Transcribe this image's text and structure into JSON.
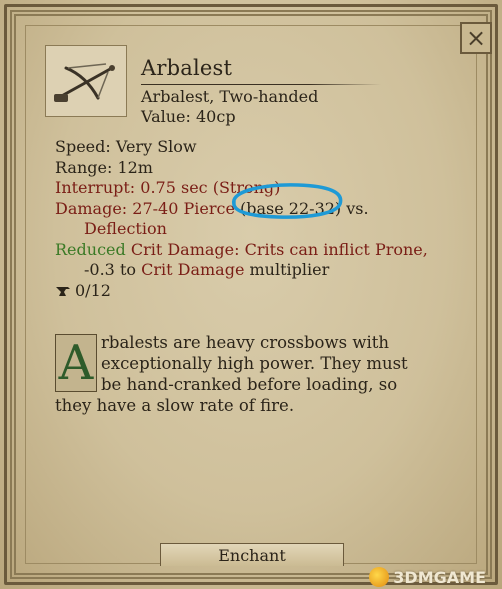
{
  "item": {
    "title": "Arbalest",
    "subtitle": "Arbalest, Two-handed",
    "value": "Value: 40cp",
    "icon": "crossbow-icon"
  },
  "stats": {
    "speed": "Speed: Very Slow",
    "range": "Range: 12m",
    "interrupt": "Interrupt: 0.75 sec (Strong)",
    "damage_label": "Damage: 27-40",
    "damage_type": "Pierce",
    "damage_base": "(base 22-32) vs.",
    "damage_vs": "Deflection",
    "reduced": "Reduced",
    "crit_label": "Crit Damage:",
    "crit_text1": "Crits can inflict",
    "crit_status": "Prone,",
    "crit_text2": "-0.3 to",
    "crit_mult_label": "Crit Damage",
    "crit_text3": "multiplier",
    "enchant_slots": "0/12"
  },
  "description": {
    "drop_cap": "A",
    "text": "rbalests are heavy crossbows with exceptionally high power. They must be hand-cranked before loading, so they have a slow rate of fire."
  },
  "buttons": {
    "enchant": "Enchant",
    "close": "×"
  },
  "watermark": "3DMGAME",
  "colors": {
    "parchment": "#cfc09b",
    "text": "#2b2419",
    "keyword_red": "#7a1e16",
    "keyword_green": "#3b7a26",
    "annotation_blue": "#1e9ad6"
  }
}
